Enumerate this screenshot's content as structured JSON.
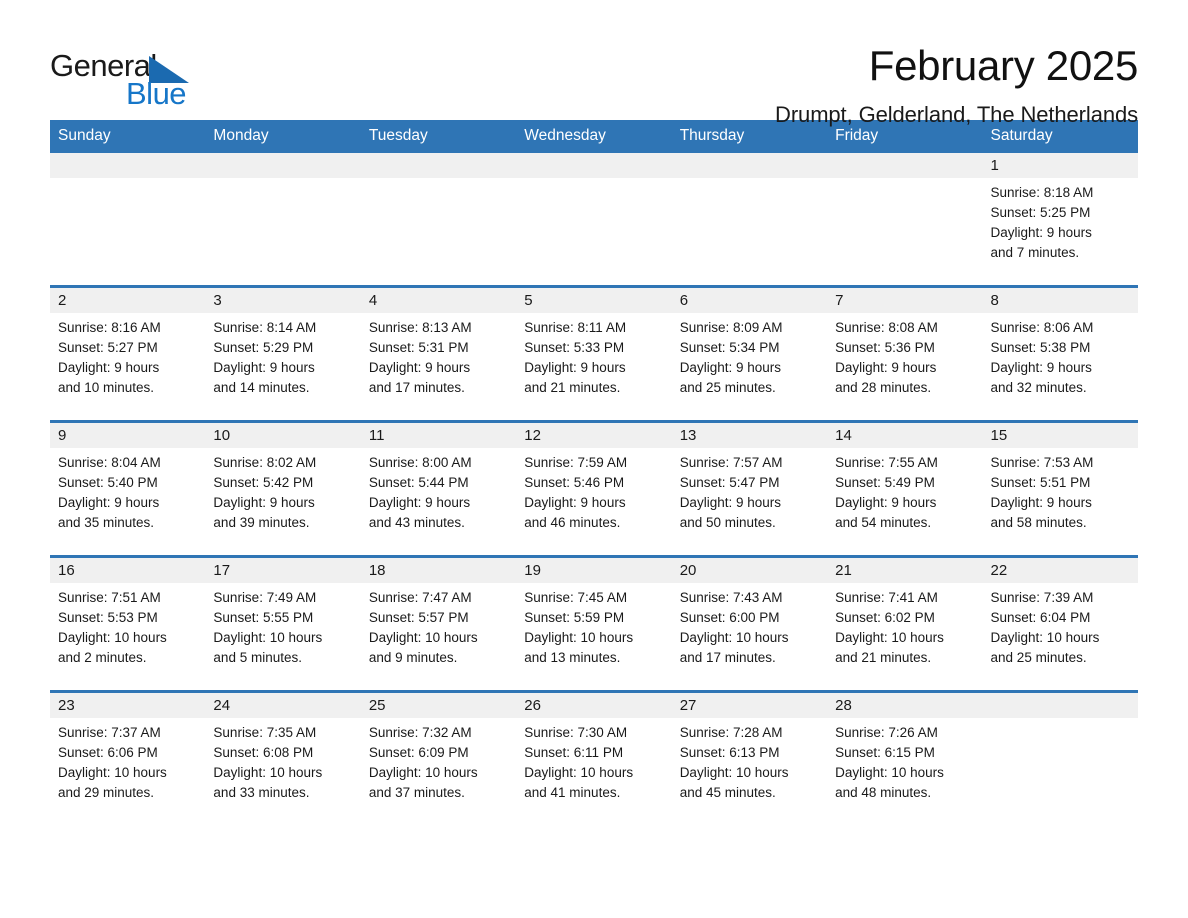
{
  "brand": {
    "name_part1": "General",
    "name_part2": "Blue",
    "triangle_icon": "triangle-icon",
    "accent_color": "#1676c8",
    "header_color": "#2f75b5"
  },
  "header": {
    "title": "February 2025",
    "location": "Drumpt, Gelderland, The Netherlands"
  },
  "calendar": {
    "weekday_headers": [
      "Sunday",
      "Monday",
      "Tuesday",
      "Wednesday",
      "Thursday",
      "Friday",
      "Saturday"
    ],
    "weeks": [
      [
        {
          "day": "",
          "sunrise": "",
          "sunset": "",
          "daylight_line1": "",
          "daylight_line2": ""
        },
        {
          "day": "",
          "sunrise": "",
          "sunset": "",
          "daylight_line1": "",
          "daylight_line2": ""
        },
        {
          "day": "",
          "sunrise": "",
          "sunset": "",
          "daylight_line1": "",
          "daylight_line2": ""
        },
        {
          "day": "",
          "sunrise": "",
          "sunset": "",
          "daylight_line1": "",
          "daylight_line2": ""
        },
        {
          "day": "",
          "sunrise": "",
          "sunset": "",
          "daylight_line1": "",
          "daylight_line2": ""
        },
        {
          "day": "",
          "sunrise": "",
          "sunset": "",
          "daylight_line1": "",
          "daylight_line2": ""
        },
        {
          "day": "1",
          "sunrise": "Sunrise: 8:18 AM",
          "sunset": "Sunset: 5:25 PM",
          "daylight_line1": "Daylight: 9 hours",
          "daylight_line2": "and 7 minutes."
        }
      ],
      [
        {
          "day": "2",
          "sunrise": "Sunrise: 8:16 AM",
          "sunset": "Sunset: 5:27 PM",
          "daylight_line1": "Daylight: 9 hours",
          "daylight_line2": "and 10 minutes."
        },
        {
          "day": "3",
          "sunrise": "Sunrise: 8:14 AM",
          "sunset": "Sunset: 5:29 PM",
          "daylight_line1": "Daylight: 9 hours",
          "daylight_line2": "and 14 minutes."
        },
        {
          "day": "4",
          "sunrise": "Sunrise: 8:13 AM",
          "sunset": "Sunset: 5:31 PM",
          "daylight_line1": "Daylight: 9 hours",
          "daylight_line2": "and 17 minutes."
        },
        {
          "day": "5",
          "sunrise": "Sunrise: 8:11 AM",
          "sunset": "Sunset: 5:33 PM",
          "daylight_line1": "Daylight: 9 hours",
          "daylight_line2": "and 21 minutes."
        },
        {
          "day": "6",
          "sunrise": "Sunrise: 8:09 AM",
          "sunset": "Sunset: 5:34 PM",
          "daylight_line1": "Daylight: 9 hours",
          "daylight_line2": "and 25 minutes."
        },
        {
          "day": "7",
          "sunrise": "Sunrise: 8:08 AM",
          "sunset": "Sunset: 5:36 PM",
          "daylight_line1": "Daylight: 9 hours",
          "daylight_line2": "and 28 minutes."
        },
        {
          "day": "8",
          "sunrise": "Sunrise: 8:06 AM",
          "sunset": "Sunset: 5:38 PM",
          "daylight_line1": "Daylight: 9 hours",
          "daylight_line2": "and 32 minutes."
        }
      ],
      [
        {
          "day": "9",
          "sunrise": "Sunrise: 8:04 AM",
          "sunset": "Sunset: 5:40 PM",
          "daylight_line1": "Daylight: 9 hours",
          "daylight_line2": "and 35 minutes."
        },
        {
          "day": "10",
          "sunrise": "Sunrise: 8:02 AM",
          "sunset": "Sunset: 5:42 PM",
          "daylight_line1": "Daylight: 9 hours",
          "daylight_line2": "and 39 minutes."
        },
        {
          "day": "11",
          "sunrise": "Sunrise: 8:00 AM",
          "sunset": "Sunset: 5:44 PM",
          "daylight_line1": "Daylight: 9 hours",
          "daylight_line2": "and 43 minutes."
        },
        {
          "day": "12",
          "sunrise": "Sunrise: 7:59 AM",
          "sunset": "Sunset: 5:46 PM",
          "daylight_line1": "Daylight: 9 hours",
          "daylight_line2": "and 46 minutes."
        },
        {
          "day": "13",
          "sunrise": "Sunrise: 7:57 AM",
          "sunset": "Sunset: 5:47 PM",
          "daylight_line1": "Daylight: 9 hours",
          "daylight_line2": "and 50 minutes."
        },
        {
          "day": "14",
          "sunrise": "Sunrise: 7:55 AM",
          "sunset": "Sunset: 5:49 PM",
          "daylight_line1": "Daylight: 9 hours",
          "daylight_line2": "and 54 minutes."
        },
        {
          "day": "15",
          "sunrise": "Sunrise: 7:53 AM",
          "sunset": "Sunset: 5:51 PM",
          "daylight_line1": "Daylight: 9 hours",
          "daylight_line2": "and 58 minutes."
        }
      ],
      [
        {
          "day": "16",
          "sunrise": "Sunrise: 7:51 AM",
          "sunset": "Sunset: 5:53 PM",
          "daylight_line1": "Daylight: 10 hours",
          "daylight_line2": "and 2 minutes."
        },
        {
          "day": "17",
          "sunrise": "Sunrise: 7:49 AM",
          "sunset": "Sunset: 5:55 PM",
          "daylight_line1": "Daylight: 10 hours",
          "daylight_line2": "and 5 minutes."
        },
        {
          "day": "18",
          "sunrise": "Sunrise: 7:47 AM",
          "sunset": "Sunset: 5:57 PM",
          "daylight_line1": "Daylight: 10 hours",
          "daylight_line2": "and 9 minutes."
        },
        {
          "day": "19",
          "sunrise": "Sunrise: 7:45 AM",
          "sunset": "Sunset: 5:59 PM",
          "daylight_line1": "Daylight: 10 hours",
          "daylight_line2": "and 13 minutes."
        },
        {
          "day": "20",
          "sunrise": "Sunrise: 7:43 AM",
          "sunset": "Sunset: 6:00 PM",
          "daylight_line1": "Daylight: 10 hours",
          "daylight_line2": "and 17 minutes."
        },
        {
          "day": "21",
          "sunrise": "Sunrise: 7:41 AM",
          "sunset": "Sunset: 6:02 PM",
          "daylight_line1": "Daylight: 10 hours",
          "daylight_line2": "and 21 minutes."
        },
        {
          "day": "22",
          "sunrise": "Sunrise: 7:39 AM",
          "sunset": "Sunset: 6:04 PM",
          "daylight_line1": "Daylight: 10 hours",
          "daylight_line2": "and 25 minutes."
        }
      ],
      [
        {
          "day": "23",
          "sunrise": "Sunrise: 7:37 AM",
          "sunset": "Sunset: 6:06 PM",
          "daylight_line1": "Daylight: 10 hours",
          "daylight_line2": "and 29 minutes."
        },
        {
          "day": "24",
          "sunrise": "Sunrise: 7:35 AM",
          "sunset": "Sunset: 6:08 PM",
          "daylight_line1": "Daylight: 10 hours",
          "daylight_line2": "and 33 minutes."
        },
        {
          "day": "25",
          "sunrise": "Sunrise: 7:32 AM",
          "sunset": "Sunset: 6:09 PM",
          "daylight_line1": "Daylight: 10 hours",
          "daylight_line2": "and 37 minutes."
        },
        {
          "day": "26",
          "sunrise": "Sunrise: 7:30 AM",
          "sunset": "Sunset: 6:11 PM",
          "daylight_line1": "Daylight: 10 hours",
          "daylight_line2": "and 41 minutes."
        },
        {
          "day": "27",
          "sunrise": "Sunrise: 7:28 AM",
          "sunset": "Sunset: 6:13 PM",
          "daylight_line1": "Daylight: 10 hours",
          "daylight_line2": "and 45 minutes."
        },
        {
          "day": "28",
          "sunrise": "Sunrise: 7:26 AM",
          "sunset": "Sunset: 6:15 PM",
          "daylight_line1": "Daylight: 10 hours",
          "daylight_line2": "and 48 minutes."
        },
        {
          "day": "",
          "sunrise": "",
          "sunset": "",
          "daylight_line1": "",
          "daylight_line2": ""
        }
      ]
    ]
  }
}
